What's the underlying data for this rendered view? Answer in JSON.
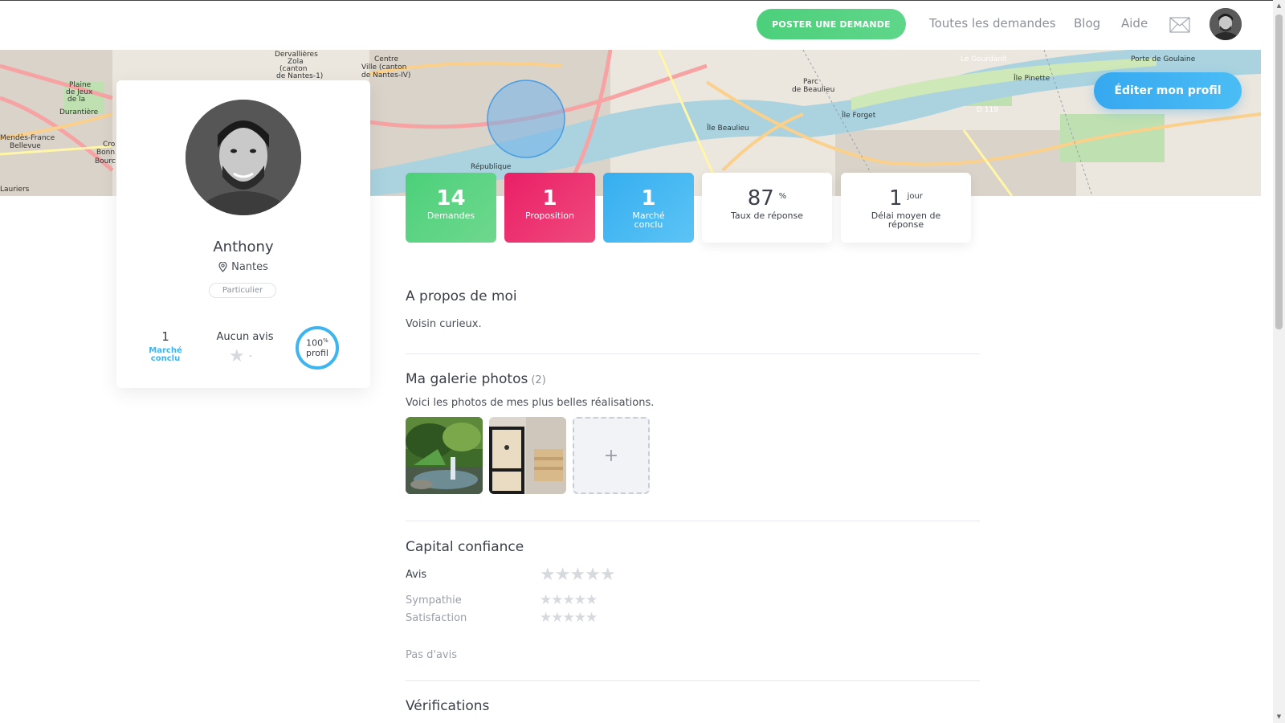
{
  "nav": {
    "post_button": "POSTER UNE DEMANDE",
    "links": [
      "Toutes les demandes",
      "Blog",
      "Aide"
    ],
    "mail_icon": "envelope-icon"
  },
  "header": {
    "edit_button": "Éditer mon profil"
  },
  "map": {
    "labels": [
      "Dervallières",
      "Zola",
      "(canton",
      "de Nantes-1)",
      "Centre",
      "Ville (canton",
      "de Nantes-IV)",
      "Plaine",
      "de Jeux",
      "de la",
      "Durantière",
      "Mendès-France",
      "Bellevue",
      "Cro",
      "Bonn",
      "Bourc",
      "Lauriers",
      "République",
      "Parc",
      "de Beaulieu",
      "Île Beaulieu",
      "Île Pinette",
      "Île Forget",
      "Le Gourdanlt",
      "D 119",
      "Porte de Goulaine"
    ]
  },
  "profile": {
    "name": "Anthony",
    "city": "Nantes",
    "badge": "Particulier",
    "deals_count": "1",
    "deals_label": "Marché conclu",
    "reviews_label": "Aucun avis",
    "reviews_dash": "-",
    "completion_value": "100",
    "completion_unit": "%",
    "completion_label": "profil",
    "completion_fraction": 1.0
  },
  "tiles": [
    {
      "num": "14",
      "label": "Demandes"
    },
    {
      "num": "1",
      "label": "Proposition"
    },
    {
      "num": "1",
      "label": "Marché conclu"
    },
    {
      "num": "87",
      "sup": "%",
      "label": "Taux de réponse"
    },
    {
      "num": "1",
      "sup": "jour",
      "label": "Délai moyen de réponse"
    }
  ],
  "about": {
    "title": "A propos de moi",
    "text": "Voisin curieux."
  },
  "gallery": {
    "title": "Ma galerie photos",
    "count": "(2)",
    "text": "Voici les photos de mes plus belles réalisations.",
    "add_label": "+"
  },
  "trust": {
    "title": "Capital confiance",
    "rows": [
      {
        "label": "Avis",
        "stars": "★★★★★"
      },
      {
        "label": "Sympathie",
        "stars": "★★★★★"
      },
      {
        "label": "Satisfaction",
        "stars": "★★★★★"
      }
    ],
    "no_reviews": "Pas d'avis"
  },
  "verifications": {
    "title": "Vérifications"
  },
  "colors": {
    "green": "#4cd07a",
    "pink": "#e8266d",
    "blue": "#3eb4f0",
    "text": "#3a3f48"
  }
}
